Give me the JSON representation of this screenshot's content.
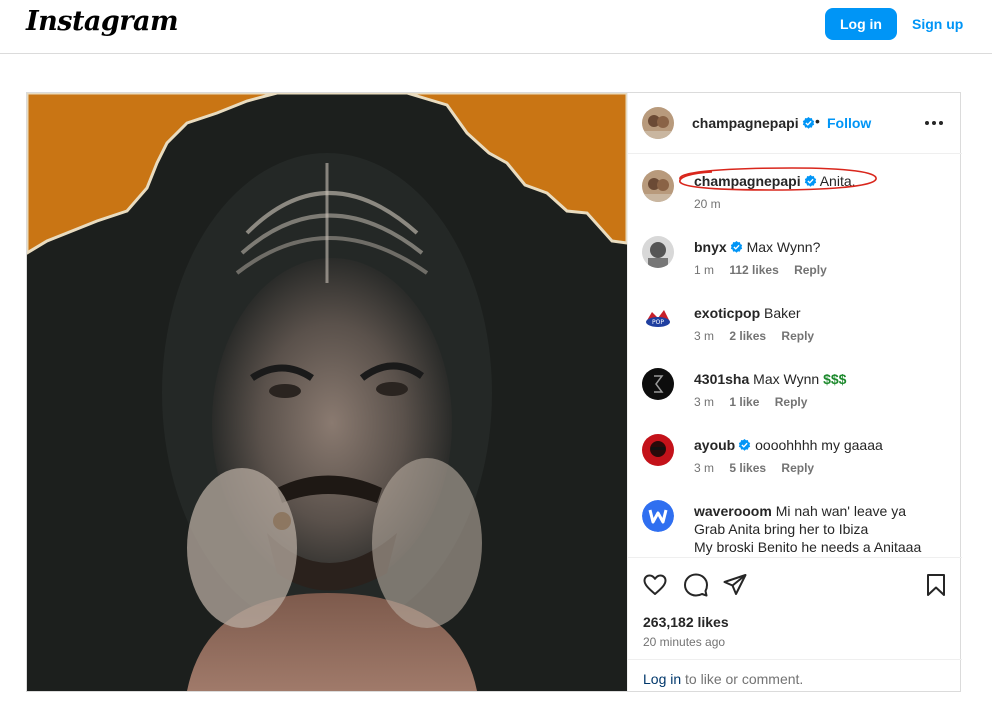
{
  "app": {
    "logo_text": "Instagram"
  },
  "topbar": {
    "login_label": "Log in",
    "signup_label": "Sign up"
  },
  "post": {
    "author": "champagnepapi",
    "separator": "•",
    "follow_label": "Follow",
    "caption": {
      "username": "champagnepapi",
      "text": "Anita.",
      "time": "20 m",
      "highlight_color": "#d9261c"
    },
    "comments": [
      {
        "username": "bnyx",
        "text": "Max Wynn?",
        "time": "1 m",
        "likes": "112 likes",
        "reply": "Reply",
        "verified": true
      },
      {
        "username": "exoticpop",
        "text": "Baker",
        "time": "3 m",
        "likes": "2 likes",
        "reply": "Reply",
        "verified": false
      },
      {
        "username": "4301sha",
        "text": "Max Wynn",
        "emoji": "$$$",
        "time": "3 m",
        "likes": "1 like",
        "reply": "Reply",
        "verified": false
      },
      {
        "username": "ayoub",
        "text": "oooohhhh my gaaaa",
        "time": "3 m",
        "likes": "5 likes",
        "reply": "Reply",
        "verified": true
      },
      {
        "username": "waverooom",
        "text": "Mi nah wan' leave ya",
        "line2": "Grab Anita bring her to Ibiza",
        "line3": "My broski Benito he needs a Anitaaa",
        "verified": false
      }
    ],
    "likes_count": "263,182 likes",
    "posted_ago": "20 minutes ago",
    "login_prompt": {
      "link": "Log in",
      "rest": " to like or comment."
    },
    "icons": [
      "heart-icon",
      "comment-icon",
      "share-icon",
      "bookmark-icon",
      "more-icon",
      "verified-badge-icon"
    ]
  },
  "colors": {
    "accent": "#0095f6",
    "verified": "#0095f6",
    "link_dark": "#00376b",
    "muted": "#737373"
  }
}
